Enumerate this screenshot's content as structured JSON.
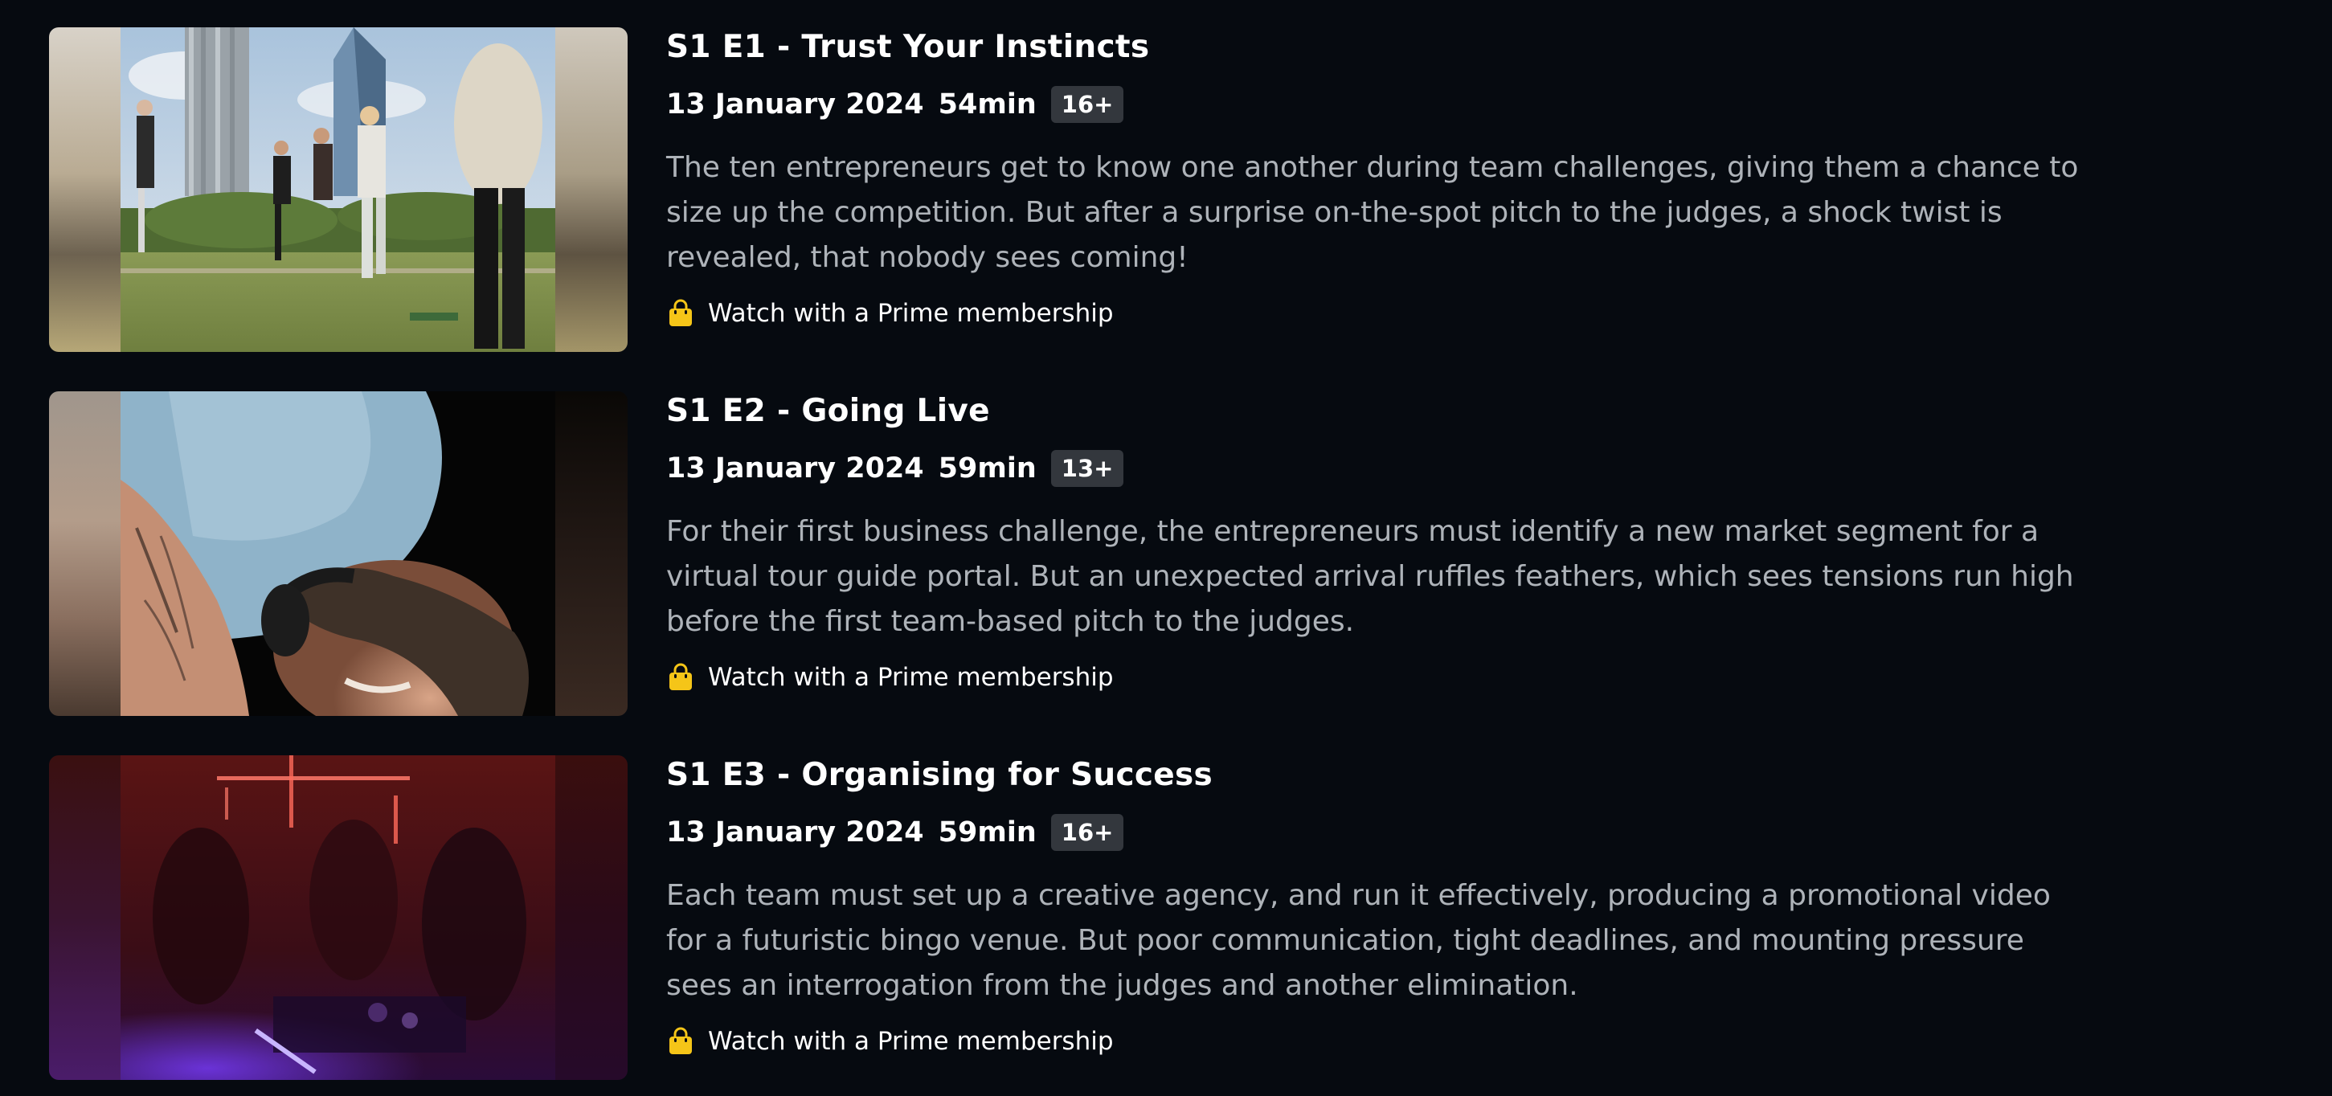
{
  "episodes": [
    {
      "title": "S1 E1 - Trust Your Instincts",
      "date": "13 January 2024",
      "runtime": "54min",
      "rating": "16+",
      "synopsis": "The ten entrepreneurs get to know one another during team challenges, giving them a chance to size up the competition. But after a surprise on-the-spot pitch to the judges, a shock twist is revealed, that nobody sees coming!",
      "watch_label": "Watch with a Prime membership"
    },
    {
      "title": "S1 E2 - Going Live",
      "date": "13 January 2024",
      "runtime": "59min",
      "rating": "13+",
      "synopsis": "For their first business challenge, the entrepreneurs must identify a new market segment for a virtual tour guide portal. But an unexpected arrival ruffles feathers, which sees tensions run high before the first team-based pitch to the judges.",
      "watch_label": "Watch with a Prime membership"
    },
    {
      "title": "S1 E3 - Organising for Success",
      "date": "13 January 2024",
      "runtime": "59min",
      "rating": "16+",
      "synopsis": "Each team must set up a creative agency, and run it effectively, producing a promotional video for a futuristic bingo venue. But poor communication, tight deadlines, and mounting pressure sees an interrogation from the judges and another elimination.",
      "watch_label": "Watch with a Prime membership"
    }
  ],
  "colors": {
    "background": "#060a10",
    "synopsis_text": "#aeb3b9",
    "rating_badge": "#33373d",
    "prime_bag": "#f5c518"
  },
  "icons": {
    "watch": "shopping-bag-icon"
  }
}
